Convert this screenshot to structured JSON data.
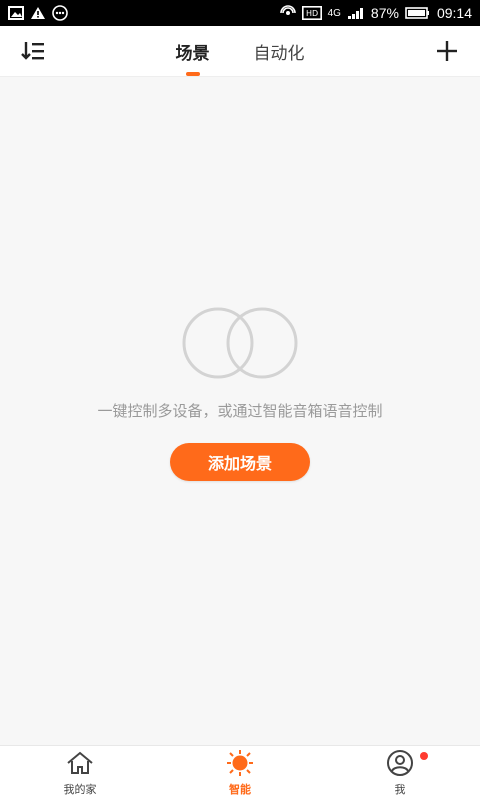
{
  "status": {
    "left_icons": [
      "image-icon",
      "warning-icon",
      "dots-icon"
    ],
    "right_icons": [
      "hotspot-icon",
      "hd-icon",
      "signal-icon"
    ],
    "network": "4G",
    "battery_percent": "87%",
    "time": "09:14"
  },
  "header": {
    "tabs": [
      {
        "label": "场景",
        "active": true
      },
      {
        "label": "自动化",
        "active": false
      }
    ]
  },
  "empty": {
    "text": "一键控制多设备，或通过智能音箱语音控制",
    "button_label": "添加场景"
  },
  "bottom_nav": {
    "items": [
      {
        "label": "我的家",
        "icon": "home-icon"
      },
      {
        "label": "智能",
        "icon": "sun-icon",
        "active": true
      },
      {
        "label": "我",
        "icon": "user-icon",
        "badge": true
      }
    ]
  },
  "colors": {
    "accent": "#ff6a1a",
    "bg": "#f7f7f7",
    "text_muted": "#9a9a9a",
    "badge": "#ff3b30"
  }
}
